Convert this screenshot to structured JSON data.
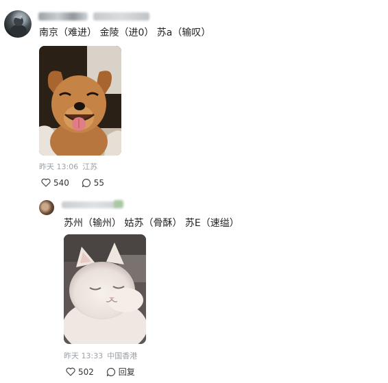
{
  "comments": [
    {
      "text": "南京（难进） 金陵（进0） 苏a（输叹）",
      "image": "dog-meme-photo",
      "time": "昨天 13:06",
      "location": "江苏",
      "likes": "540",
      "replies": "55"
    },
    {
      "text": "苏州（输州） 姑苏（骨酥） 苏E（速缢）",
      "image": "cat-meme-photo",
      "time": "昨天 13:33",
      "location": "中国香港",
      "likes": "502",
      "reply_label": "回复"
    }
  ],
  "icons": {
    "like": "heart-outline-icon",
    "comment": "speech-bubble-icon"
  },
  "colors": {
    "meta_text": "#9aa0a6",
    "body_text": "#222222"
  }
}
